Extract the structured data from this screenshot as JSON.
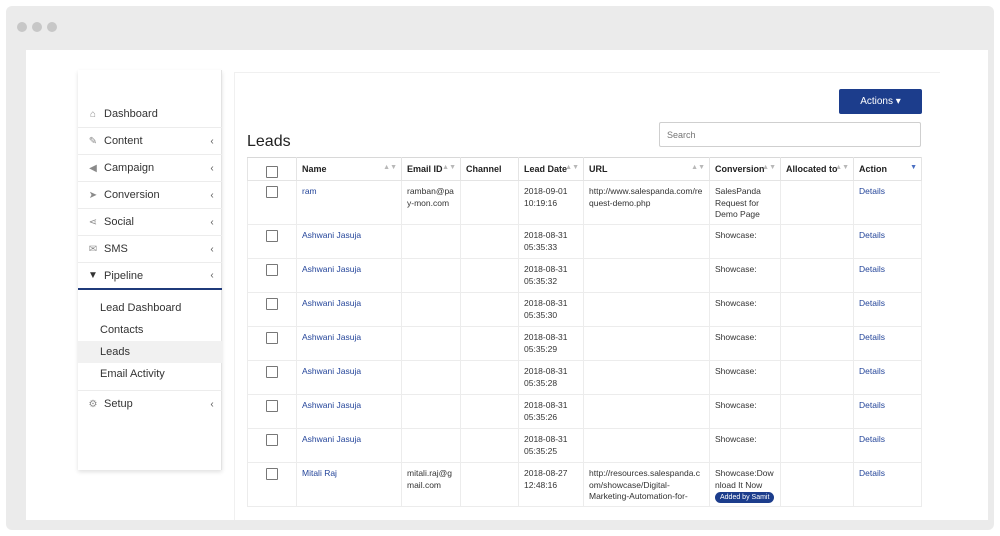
{
  "sidebar": {
    "items": [
      {
        "label": "Dashboard",
        "icon": "home-icon",
        "chevron": ""
      },
      {
        "label": "Content",
        "icon": "edit-icon",
        "chevron": "‹"
      },
      {
        "label": "Campaign",
        "icon": "megaphone-icon",
        "chevron": "‹"
      },
      {
        "label": "Conversion",
        "icon": "cursor-icon",
        "chevron": "‹"
      },
      {
        "label": "Social",
        "icon": "share-icon",
        "chevron": "‹"
      },
      {
        "label": "SMS",
        "icon": "envelope-icon",
        "chevron": "‹"
      },
      {
        "label": "Pipeline",
        "icon": "filter-icon",
        "chevron": "‹"
      }
    ],
    "pipeline_sub": [
      "Lead Dashboard",
      "Contacts",
      "Leads",
      "Email Activity"
    ],
    "setup": {
      "label": "Setup",
      "icon": "gear-icon",
      "chevron": "‹"
    }
  },
  "main": {
    "actions_label": "Actions ▾",
    "title": "Leads",
    "search_placeholder": "Search"
  },
  "table": {
    "headers": [
      "Name",
      "Email ID",
      "Channel",
      "Lead Date",
      "URL",
      "Conversion",
      "Allocated to",
      "Action"
    ],
    "rows": [
      {
        "name": "ram",
        "email": "ramban@pay-mon.com",
        "channel": "",
        "date": "2018-09-01 10:19:16",
        "url": "http://www.salespanda.com/request-demo.php",
        "conversion": "SalesPanda Request for Demo Page",
        "tag": "",
        "allocated": "",
        "action": "Details"
      },
      {
        "name": "Ashwani Jasuja",
        "email": "",
        "channel": "",
        "date": "2018-08-31 05:35:33",
        "url": "",
        "conversion": "Showcase:",
        "tag": "",
        "allocated": "",
        "action": "Details"
      },
      {
        "name": "Ashwani Jasuja",
        "email": "",
        "channel": "",
        "date": "2018-08-31 05:35:32",
        "url": "",
        "conversion": "Showcase:",
        "tag": "",
        "allocated": "",
        "action": "Details"
      },
      {
        "name": "Ashwani Jasuja",
        "email": "",
        "channel": "",
        "date": "2018-08-31 05:35:30",
        "url": "",
        "conversion": "Showcase:",
        "tag": "",
        "allocated": "",
        "action": "Details"
      },
      {
        "name": "Ashwani Jasuja",
        "email": "",
        "channel": "",
        "date": "2018-08-31 05:35:29",
        "url": "",
        "conversion": "Showcase:",
        "tag": "",
        "allocated": "",
        "action": "Details"
      },
      {
        "name": "Ashwani Jasuja",
        "email": "",
        "channel": "",
        "date": "2018-08-31 05:35:28",
        "url": "",
        "conversion": "Showcase:",
        "tag": "",
        "allocated": "",
        "action": "Details"
      },
      {
        "name": "Ashwani Jasuja",
        "email": "",
        "channel": "",
        "date": "2018-08-31 05:35:26",
        "url": "",
        "conversion": "Showcase:",
        "tag": "",
        "allocated": "",
        "action": "Details"
      },
      {
        "name": "Ashwani Jasuja",
        "email": "",
        "channel": "",
        "date": "2018-08-31 05:35:25",
        "url": "",
        "conversion": "Showcase:",
        "tag": "",
        "allocated": "",
        "action": "Details"
      },
      {
        "name": "Mitali Raj",
        "email": "mitali.raj@gmail.com",
        "channel": "",
        "date": "2018-08-27 12:48:16",
        "url": "http://resources.salespanda.com/showcase/Digital-Marketing-Automation-for-",
        "conversion": "Showcase:Download It Now",
        "tag": "Added by Samit",
        "allocated": "",
        "action": "Details"
      }
    ]
  },
  "colors": {
    "accent": "#1c3d8c",
    "link": "#24459a"
  }
}
